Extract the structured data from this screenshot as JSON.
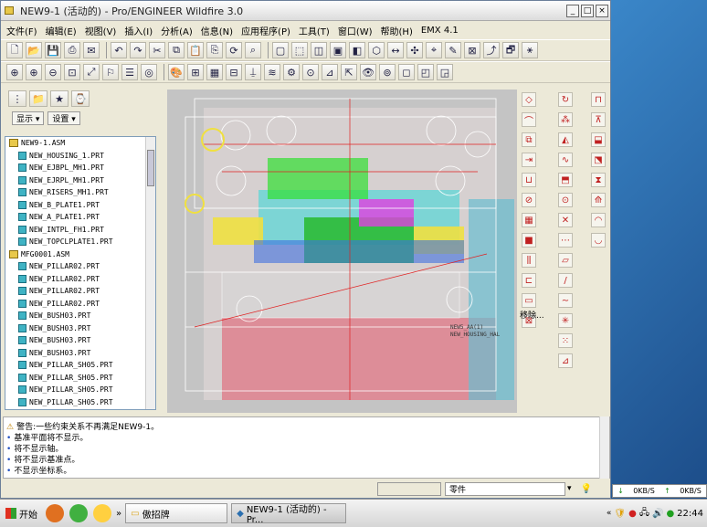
{
  "window": {
    "title": "NEW9-1 (活动的) - Pro/ENGINEER Wildfire 3.0",
    "controls": [
      "_",
      "□",
      "×"
    ]
  },
  "menus": [
    "文件(F)",
    "编辑(E)",
    "视图(V)",
    "插入(I)",
    "分析(A)",
    "信息(N)",
    "应用程序(P)",
    "工具(T)",
    "窗口(W)",
    "帮助(H)",
    "EMX 4.1"
  ],
  "navigator": {
    "show_label": "显示 ▾",
    "settings_label": "设置 ▾",
    "tree": [
      {
        "label": "NEW9-1.ASM",
        "kind": "asm",
        "indent": 0
      },
      {
        "label": "NEW_HOUSING_1.PRT",
        "kind": "prt",
        "indent": 1
      },
      {
        "label": "NEW_EJBPL_MH1.PRT",
        "kind": "prt",
        "indent": 1
      },
      {
        "label": "NEW_EJRPL_MH1.PRT",
        "kind": "prt",
        "indent": 1
      },
      {
        "label": "NEW_RISERS_MH1.PRT",
        "kind": "prt",
        "indent": 1
      },
      {
        "label": "NEW_B_PLATE1.PRT",
        "kind": "prt",
        "indent": 1
      },
      {
        "label": "NEW_A_PLATE1.PRT",
        "kind": "prt",
        "indent": 1
      },
      {
        "label": "NEW_INTPL_FH1.PRT",
        "kind": "prt",
        "indent": 1
      },
      {
        "label": "NEW_TOPCLPLATE1.PRT",
        "kind": "prt",
        "indent": 1
      },
      {
        "label": "MFG0001.ASM",
        "kind": "asm",
        "indent": 0
      },
      {
        "label": "NEW_PILLAR02.PRT",
        "kind": "prt",
        "indent": 1
      },
      {
        "label": "NEW_PILLAR02.PRT",
        "kind": "prt",
        "indent": 1
      },
      {
        "label": "NEW_PILLAR02.PRT",
        "kind": "prt",
        "indent": 1
      },
      {
        "label": "NEW_PILLAR02.PRT",
        "kind": "prt",
        "indent": 1
      },
      {
        "label": "NEW_BUSH03.PRT",
        "kind": "prt",
        "indent": 1
      },
      {
        "label": "NEW_BUSH03.PRT",
        "kind": "prt",
        "indent": 1
      },
      {
        "label": "NEW_BUSH03.PRT",
        "kind": "prt",
        "indent": 1
      },
      {
        "label": "NEW_BUSH03.PRT",
        "kind": "prt",
        "indent": 1
      },
      {
        "label": "NEW_PILLAR_SH05.PRT",
        "kind": "prt",
        "indent": 1
      },
      {
        "label": "NEW_PILLAR_SH05.PRT",
        "kind": "prt",
        "indent": 1
      },
      {
        "label": "NEW_PILLAR_SH05.PRT",
        "kind": "prt",
        "indent": 1
      },
      {
        "label": "NEW_PILLAR_SH05.PRT",
        "kind": "prt",
        "indent": 1
      }
    ]
  },
  "graphics": {
    "annotation_1": "NEW5_AA(1)",
    "annotation_2": "NEW_HOUSING_HAL"
  },
  "right_toolbar": {
    "move_label": "移除..."
  },
  "messages": [
    "警告:一些约束关系不再满足NEW9-1。",
    "基准平面将不显示。",
    "将不显示轴。",
    "将不显示基准点。",
    "不显示坐标系。"
  ],
  "status": {
    "filter_value": "零件"
  },
  "taskbar": {
    "start_label": "开始",
    "folder_task": "傲招牌",
    "app_task": "NEW9-1 (活动的) - Pr...",
    "clock": "22:44",
    "net_down": "0KB/S",
    "net_up": "0KB/S"
  },
  "colors": {
    "window_bg": "#ece9d8",
    "graphics_bg": "#c4c4c4",
    "tree_part_icon": "#3fb3c4",
    "tree_asm_icon": "#e8c84a"
  }
}
